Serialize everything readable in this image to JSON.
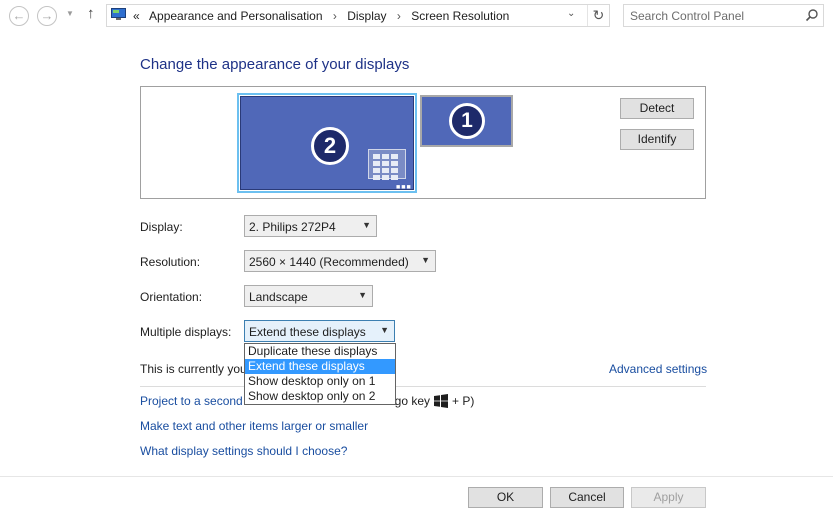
{
  "nav": {
    "breadcrumb_prefix": "«",
    "breadcrumbs": [
      "Appearance and Personalisation",
      "Display",
      "Screen Resolution"
    ],
    "breadcrumb_separator": "›",
    "search_placeholder": "Search Control Panel"
  },
  "main": {
    "title": "Change the appearance of your displays",
    "monitors": [
      {
        "number": "2",
        "selected": true
      },
      {
        "number": "1",
        "selected": false
      }
    ],
    "detect_label": "Detect",
    "identify_label": "Identify",
    "fields": {
      "display": {
        "label": "Display:",
        "value": "2. Philips 272P4"
      },
      "resolution": {
        "label": "Resolution:",
        "value": "2560 × 1440 (Recommended)"
      },
      "orientation": {
        "label": "Orientation:",
        "value": "Landscape"
      },
      "multiple": {
        "label": "Multiple displays:",
        "value": "Extend these displays"
      }
    },
    "multiple_options": [
      "Duplicate these displays",
      "Extend these displays",
      "Show desktop only on 1",
      "Show desktop only on 2"
    ],
    "status_text": "This is currently you",
    "advanced_link": "Advanced settings",
    "project_link": "Project to a second",
    "project_tail_before": "s logo key",
    "project_tail_after": "+ P)",
    "text_size_link": "Make text and other items larger or smaller",
    "help_link": "What display settings should I choose?"
  },
  "footer": {
    "ok": "OK",
    "cancel": "Cancel",
    "apply": "Apply"
  },
  "colors": {
    "title": "#1e3287",
    "link": "#1a4ea0",
    "monitor_fill": "#5068b8",
    "selected_outline": "#6cc0f0",
    "dropdown_highlight": "#3399ff"
  }
}
